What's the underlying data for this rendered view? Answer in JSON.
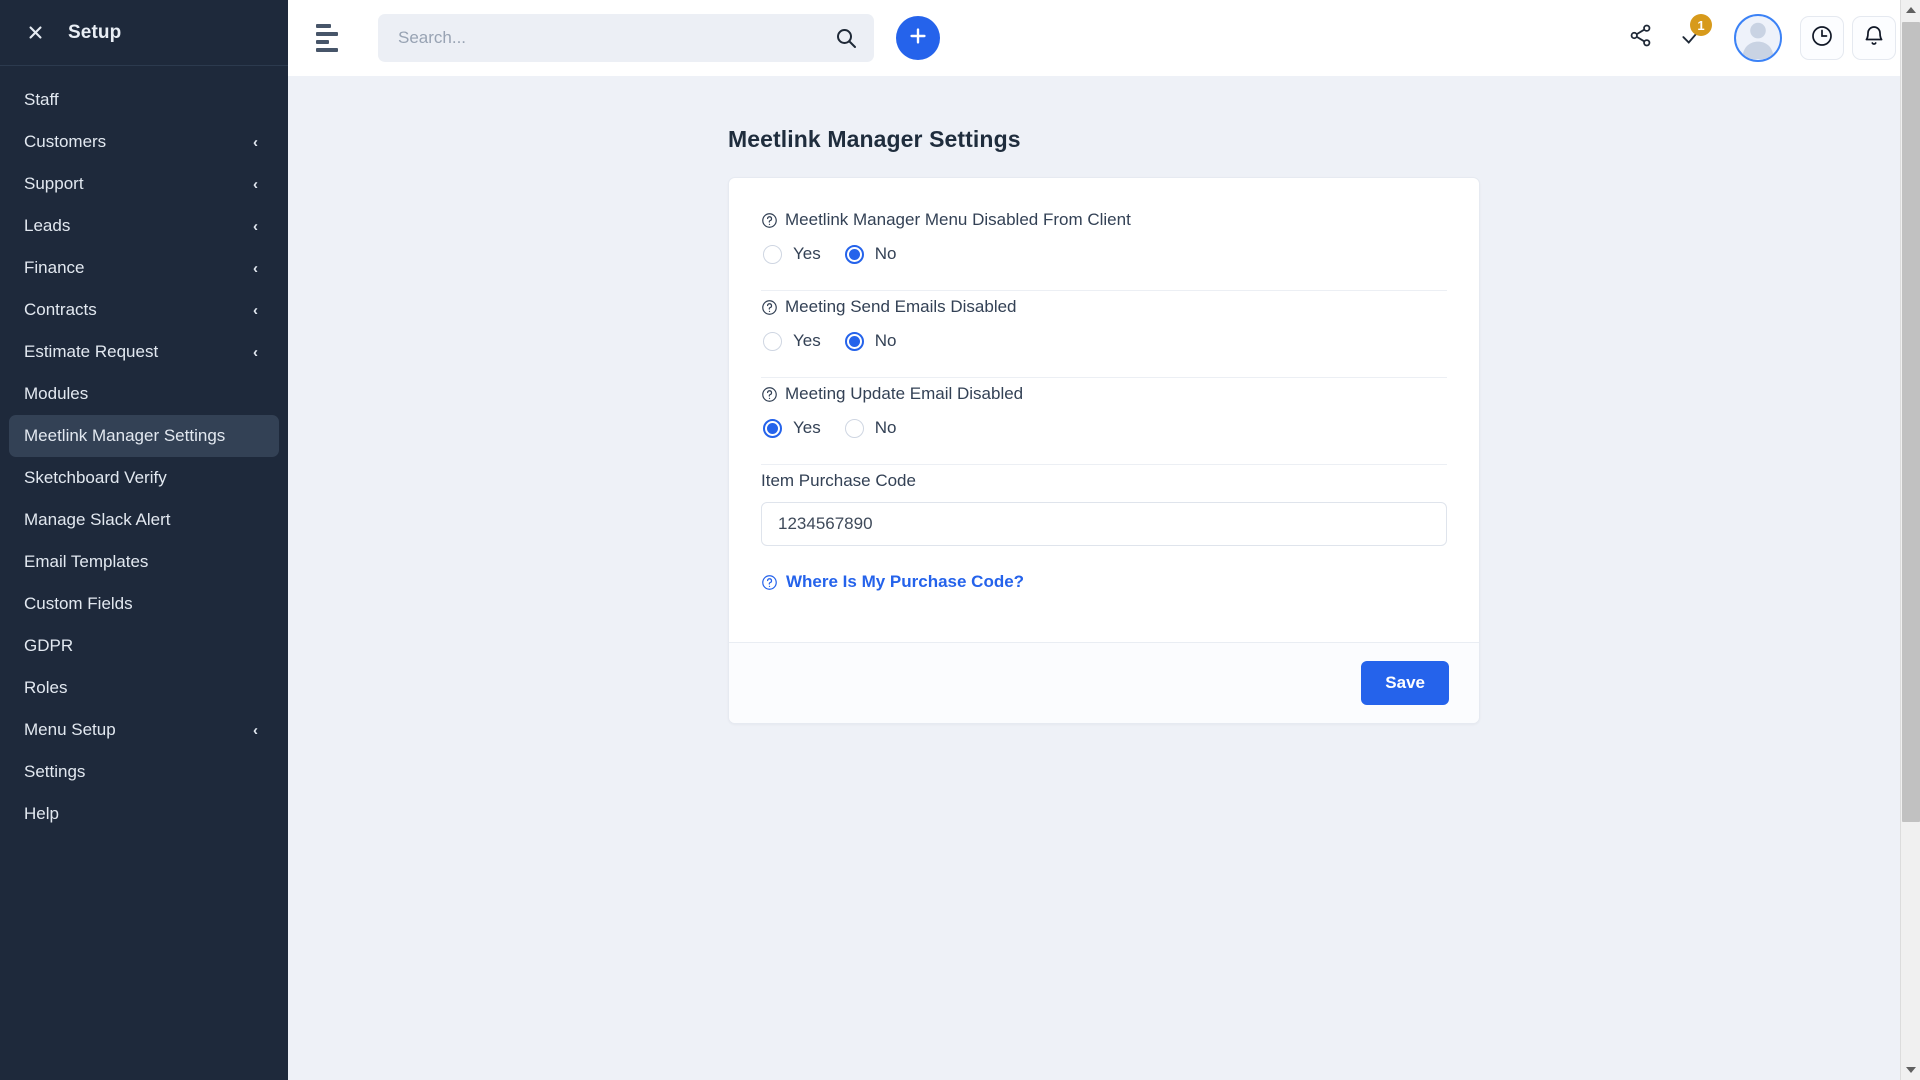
{
  "sidebar": {
    "close_icon": "close-icon",
    "title": "Setup",
    "items": [
      {
        "label": "Staff",
        "chevron": "",
        "active": false
      },
      {
        "label": "Customers",
        "chevron": "‹",
        "active": false
      },
      {
        "label": "Support",
        "chevron": "‹",
        "active": false
      },
      {
        "label": "Leads",
        "chevron": "‹",
        "active": false
      },
      {
        "label": "Finance",
        "chevron": "‹",
        "active": false
      },
      {
        "label": "Contracts",
        "chevron": "‹",
        "active": false
      },
      {
        "label": "Estimate Request",
        "chevron": "‹",
        "active": false
      },
      {
        "label": "Modules",
        "chevron": "",
        "active": false
      },
      {
        "label": "Meetlink Manager Settings",
        "chevron": "",
        "active": true
      },
      {
        "label": "Sketchboard Verify",
        "chevron": "",
        "active": false
      },
      {
        "label": "Manage Slack Alert",
        "chevron": "",
        "active": false
      },
      {
        "label": "Email Templates",
        "chevron": "",
        "active": false
      },
      {
        "label": "Custom Fields",
        "chevron": "",
        "active": false
      },
      {
        "label": "GDPR",
        "chevron": "",
        "active": false
      },
      {
        "label": "Roles",
        "chevron": "",
        "active": false
      },
      {
        "label": "Menu Setup",
        "chevron": "‹",
        "active": false
      },
      {
        "label": "Settings",
        "chevron": "",
        "active": false
      },
      {
        "label": "Help",
        "chevron": "",
        "active": false
      }
    ]
  },
  "topbar": {
    "menu_toggle_icon": "hamburger-icon",
    "search": {
      "value": "",
      "placeholder": "Search...",
      "icon": "search-icon"
    },
    "add_button_icon": "plus-icon",
    "share_icon": "share-icon",
    "tasks_icon": "checkmark-icon",
    "tasks_badge": "1",
    "avatar_icon": "user-avatar",
    "timer_icon": "clock-icon",
    "notifications_icon": "bell-icon"
  },
  "page": {
    "title": "Meetlink Manager Settings",
    "settings": [
      {
        "label": "Meetlink Manager Menu Disabled From Client",
        "help_icon": "question-mark-icon",
        "options": [
          {
            "label": "Yes",
            "selected": false
          },
          {
            "label": "No",
            "selected": true
          }
        ]
      },
      {
        "label": "Meeting Send Emails Disabled",
        "help_icon": "question-mark-icon",
        "options": [
          {
            "label": "Yes",
            "selected": false
          },
          {
            "label": "No",
            "selected": true
          }
        ]
      },
      {
        "label": "Meeting Update Email Disabled",
        "help_icon": "question-mark-icon",
        "options": [
          {
            "label": "Yes",
            "selected": true
          },
          {
            "label": "No",
            "selected": false
          }
        ]
      }
    ],
    "purchase_code": {
      "label": "Item Purchase Code",
      "value": "1234567890",
      "placeholder": ""
    },
    "purchase_help": {
      "icon": "question-mark-icon",
      "text": "Where Is My Purchase Code?"
    },
    "save_label": "Save"
  },
  "colors": {
    "sidebar_bg": "#1e293b",
    "sidebar_active": "#334155",
    "accent_blue": "#2563eb",
    "badge_gold": "#d79a1b",
    "content_bg": "#eef1f7",
    "card_bg": "#ffffff",
    "text_dark": "#334155"
  }
}
